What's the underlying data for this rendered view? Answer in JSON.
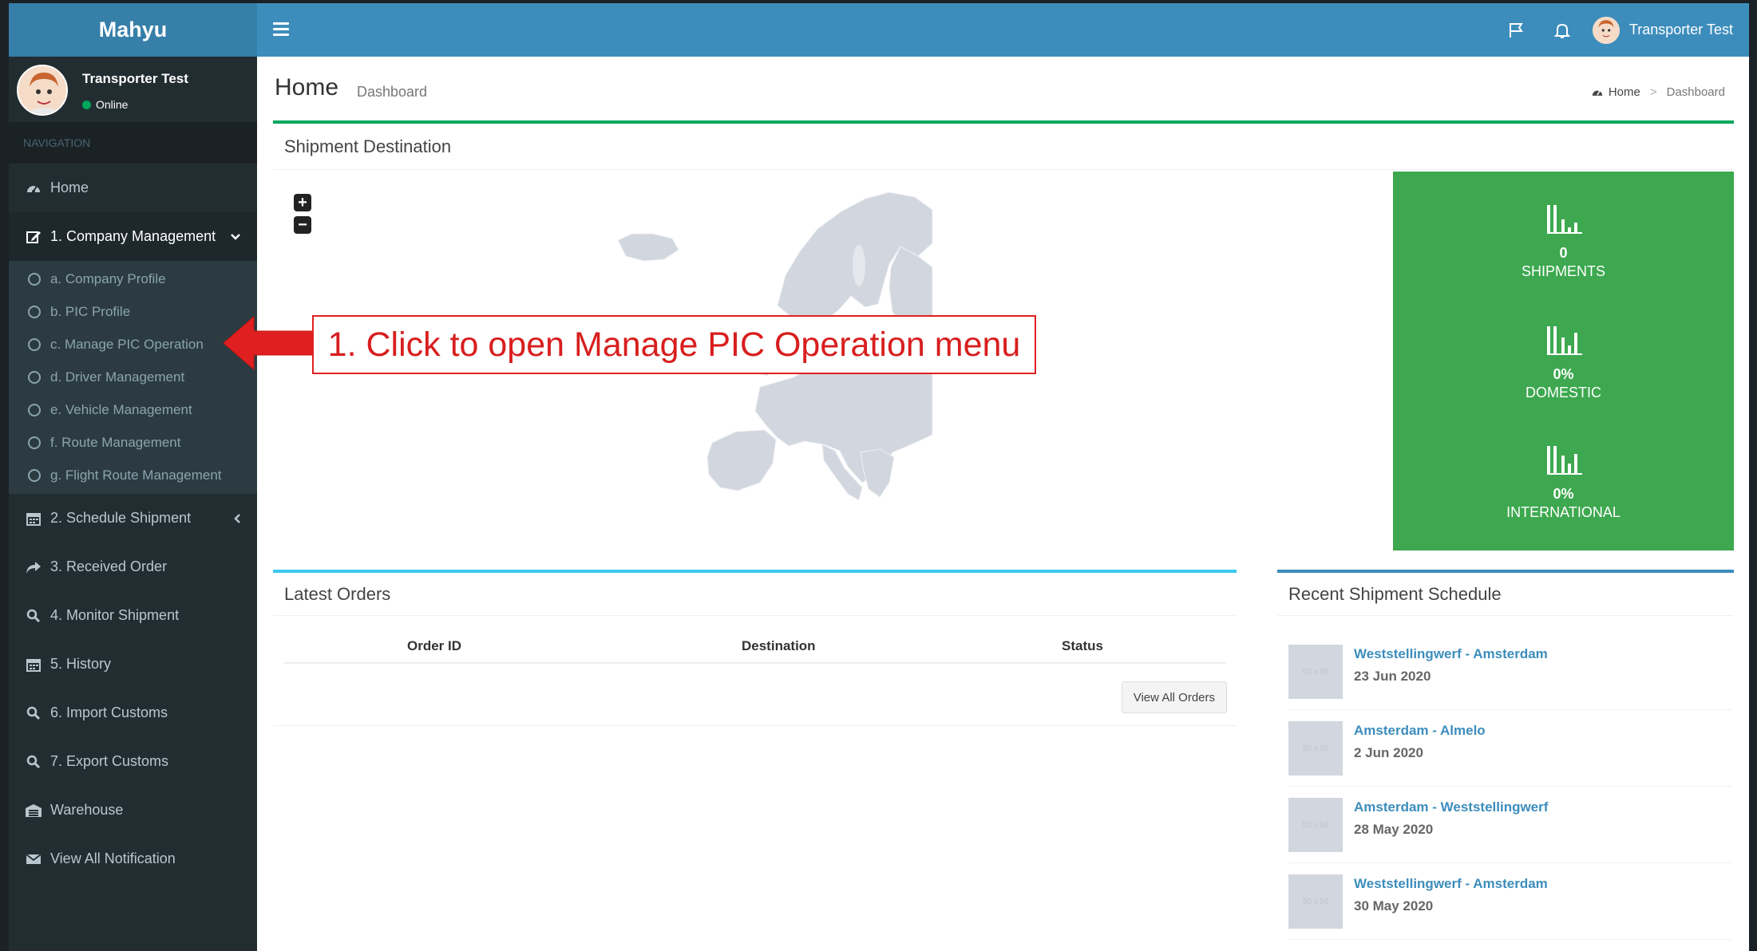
{
  "app": {
    "brand": "Mahyu"
  },
  "user": {
    "name": "Transporter Test",
    "status": "Online"
  },
  "sidebar": {
    "nav_header": "NAVIGATION",
    "items": [
      {
        "label": "Home",
        "icon": "dashboard-icon"
      },
      {
        "label": "1. Company Management",
        "icon": "edit-icon",
        "caret": "⌄"
      },
      {
        "label": "2. Schedule Shipment",
        "icon": "calendar-icon",
        "caret": "‹"
      },
      {
        "label": "3. Received Order",
        "icon": "share-icon"
      },
      {
        "label": "4. Monitor Shipment",
        "icon": "search-icon"
      },
      {
        "label": "5. History",
        "icon": "calendar-icon"
      },
      {
        "label": "6. Import Customs",
        "icon": "search-icon"
      },
      {
        "label": "7. Export Customs",
        "icon": "search-icon"
      },
      {
        "label": "Warehouse",
        "icon": "warehouse-icon"
      },
      {
        "label": "View All Notification",
        "icon": "envelope-icon"
      }
    ],
    "submenu": [
      "a. Company Profile",
      "b. PIC Profile",
      "c. Manage PIC Operation",
      "d. Driver Management",
      "e. Vehicle Management",
      "f. Route Management",
      "g. Flight Route Management"
    ]
  },
  "header": {
    "menu_icon": "hamburger-icon",
    "flag_icon": "flag-icon",
    "bell_icon": "bell-icon"
  },
  "page": {
    "title": "Home",
    "subtitle": "Dashboard",
    "breadcrumb": {
      "home": "Home",
      "current": "Dashboard",
      "separator": ">"
    }
  },
  "map_box": {
    "title": "Shipment Destination",
    "zoom_in": "+",
    "zoom_out": "−",
    "stats": [
      {
        "value": "0",
        "label": "SHIPMENTS"
      },
      {
        "value": "0%",
        "label": "DOMESTIC"
      },
      {
        "value": "0%",
        "label": "INTERNATIONAL"
      }
    ]
  },
  "orders_box": {
    "title": "Latest Orders",
    "columns": [
      "Order ID",
      "Destination",
      "Status"
    ],
    "button": "View All Orders"
  },
  "recent_box": {
    "title": "Recent Shipment Schedule",
    "thumb_text": "50 x 50",
    "items": [
      {
        "route": "Weststellingwerf - Amsterdam",
        "date": "23 Jun 2020"
      },
      {
        "route": "Amsterdam - Almelo",
        "date": "2 Jun 2020"
      },
      {
        "route": "Amsterdam - Weststellingwerf",
        "date": "28 May 2020"
      },
      {
        "route": "Weststellingwerf - Amsterdam",
        "date": "30 May 2020"
      }
    ]
  },
  "annotation": {
    "text": "1. Click to open Manage PIC Operation menu"
  },
  "colors": {
    "sidebar_bg": "#222d32",
    "header_bg": "#3c8dbc",
    "logo_bg": "#367fa9",
    "stats_bg": "#3da84f",
    "callout_red": "#e02020"
  }
}
